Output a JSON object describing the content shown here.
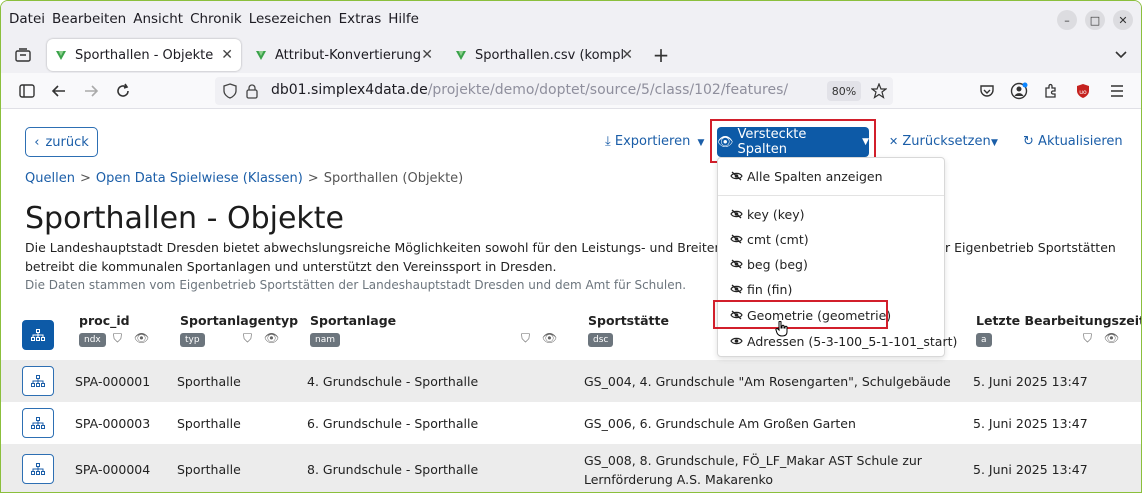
{
  "menubar": {
    "items": [
      {
        "label": "Datei",
        "accel": "D"
      },
      {
        "label": "Bearbeiten",
        "accel": "B"
      },
      {
        "label": "Ansicht",
        "accel": "A"
      },
      {
        "label": "Chronik",
        "accel": "C"
      },
      {
        "label": "Lesezeichen",
        "accel": "L"
      },
      {
        "label": "Extras",
        "accel": "x"
      },
      {
        "label": "Hilfe",
        "accel": "H"
      }
    ],
    "window_controls": {
      "minimize": "–",
      "maximize": "□",
      "close": "✕"
    }
  },
  "tabs": [
    {
      "label": "Sporthallen - Objekte",
      "active": true
    },
    {
      "label": "Attribut-Konvertierung 4",
      "active": false
    },
    {
      "label": "Sporthallen.csv (komplett",
      "active": false
    }
  ],
  "new_tab": "+",
  "navbar": {
    "url_host": "db01.simplex4data.de",
    "url_path": "/projekte/demo/doptet/source/5/class/102/features/",
    "zoom": "80%"
  },
  "page": {
    "back_label": "zurück",
    "export_label": "Exportieren",
    "hidden_columns_label": "Versteckte Spalten",
    "reset_label": "Zurücksetzen",
    "refresh_label": "Aktualisieren",
    "breadcrumb": [
      "Quellen",
      "Open Data Spielwiese (Klassen)",
      "Sporthallen (Objekte)"
    ],
    "title": "Sporthallen - Objekte",
    "description_line1": "Die Landeshauptstadt Dresden bietet abwechslungsreiche Möglichkeiten sowohl für den Leistungs- und Breitensport als au",
    "description_line1_right": "r Eigenbetrieb Sportstätten",
    "description_line2": "betreibt die kommunalen Sportanlagen und unterstützt den Vereinssport in Dresden.",
    "description_line3": "Die Daten stammen vom Eigenbetrieb Sportstätten der Landeshauptstadt Dresden und dem Amt für Schulen."
  },
  "dropdown": {
    "show_all": "Alle Spalten anzeigen",
    "items": [
      {
        "label": "key (key)",
        "hidden": true
      },
      {
        "label": "cmt (cmt)",
        "hidden": false
      },
      {
        "label": "beg (beg)",
        "hidden": true
      },
      {
        "label": "fin (fin)",
        "hidden": true
      },
      {
        "label": "Geometrie (geometrie)",
        "hidden": true
      },
      {
        "label": "Adressen (5-3-100_5-1-101_start)",
        "hidden": false
      }
    ]
  },
  "table": {
    "columns": [
      {
        "label": "proc_id",
        "tag": "ndx"
      },
      {
        "label": "Sportanlagentyp",
        "tag": "typ"
      },
      {
        "label": "Sportanlage",
        "tag": "nam"
      },
      {
        "label": "Sportstätte",
        "tag": "dsc"
      },
      {
        "label": "Letzte Bearbeitungszeit",
        "tag": "a"
      }
    ],
    "rows": [
      {
        "id": "SPA-000001",
        "typ": "Sporthalle",
        "anlage": "4. Grundschule - Sporthalle",
        "staette": "GS_004, 4. Grundschule \"Am Rosengarten\", Schulgebäude",
        "staette2": "",
        "time": "5. Juni 2025 13:47"
      },
      {
        "id": "SPA-000003",
        "typ": "Sporthalle",
        "anlage": "6. Grundschule - Sporthalle",
        "staette": "GS_006, 6. Grundschule Am Großen Garten",
        "staette2": "",
        "time": "5. Juni 2025 13:47"
      },
      {
        "id": "SPA-000004",
        "typ": "Sporthalle",
        "anlage": "8. Grundschule - Sporthalle",
        "staette": "GS_008, 8. Grundschule, FÖ_LF_Makar AST Schule zur",
        "staette2": "Lernförderung A.S. Makarenko",
        "time": "5. Juni 2025 13:47"
      }
    ]
  },
  "colors": {
    "primary": "#0d5aa7",
    "link": "#1b5ea8",
    "highlight": "#d21f2b"
  }
}
